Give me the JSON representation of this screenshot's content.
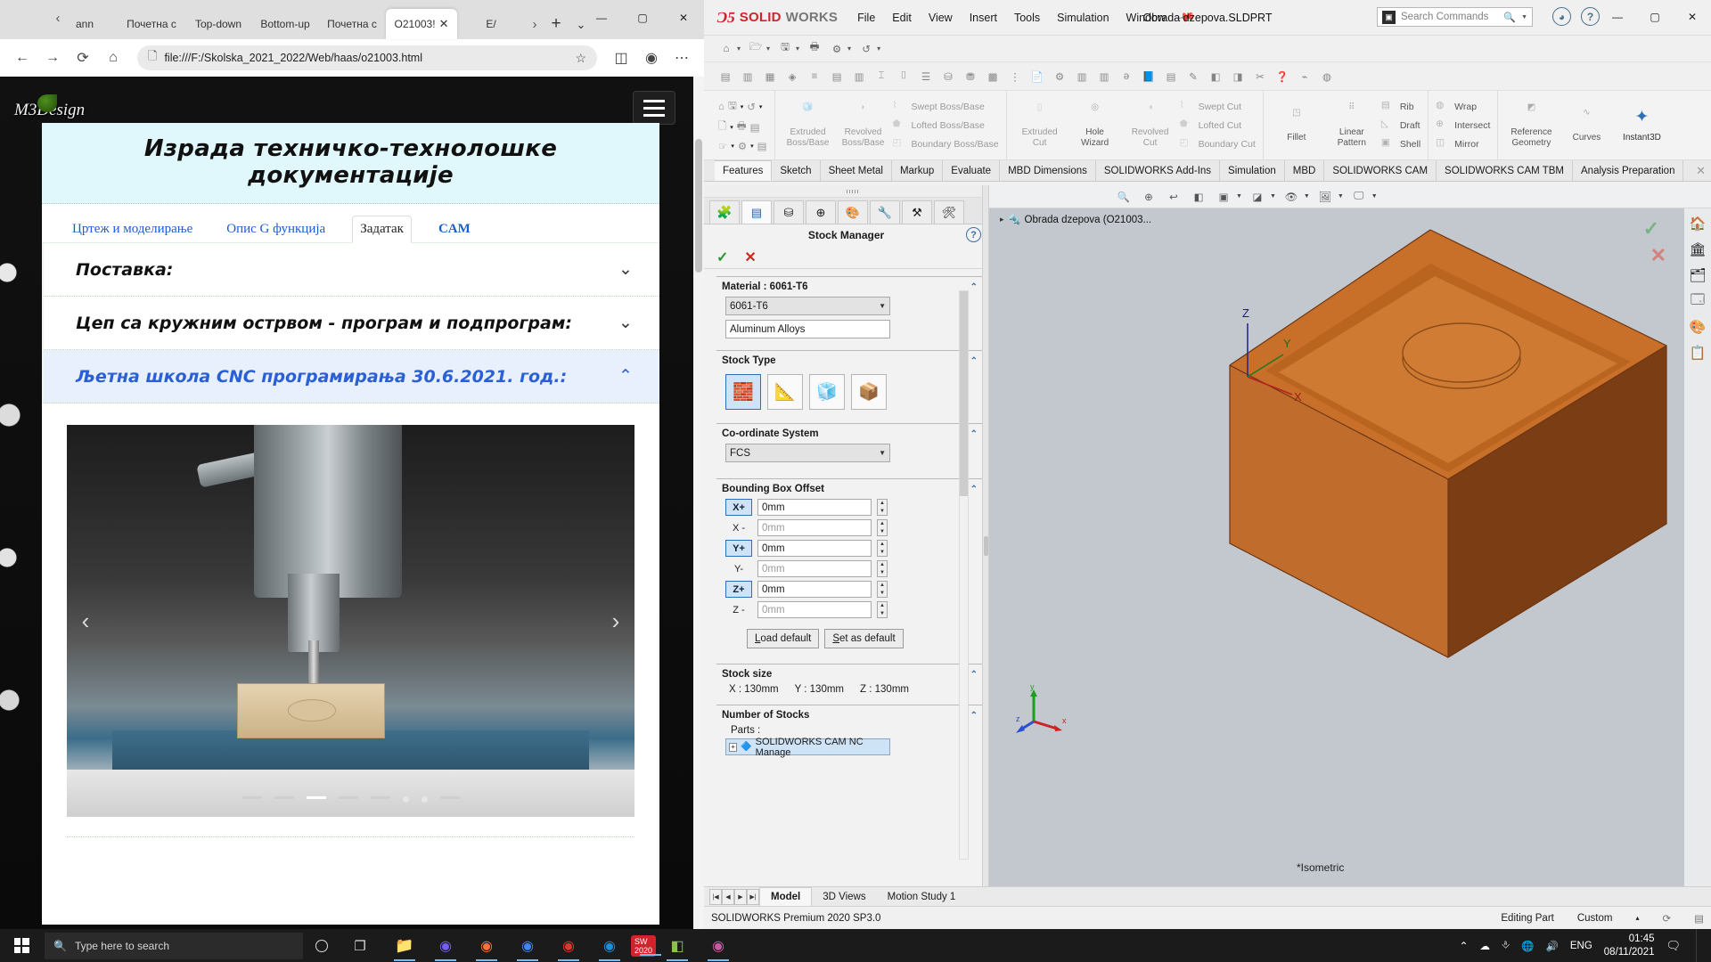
{
  "browser": {
    "tabs": [
      {
        "label": "ann",
        "active": false
      },
      {
        "label": "Почетна с",
        "active": false
      },
      {
        "label": "Top-down",
        "active": false
      },
      {
        "label": "Bottom-up",
        "active": false
      },
      {
        "label": "Почетна с",
        "active": false
      },
      {
        "label": "O21003!",
        "active": true
      },
      {
        "label": "E/",
        "active": false
      }
    ],
    "new_tab_label": "+",
    "tab_list_caret": "⌄",
    "nav_prev": "‹",
    "nav_next": "›",
    "back_icon": "←",
    "forward_icon": "→",
    "reload_icon": "⟳",
    "home_icon": "⌂",
    "url": "file:///F:/Skolska_2021_2022/Web/haas/o21003.html",
    "favorite_icon": "☆",
    "collections_icon": "◫",
    "profile_icon": "◉",
    "more_icon": "⋯",
    "window": {
      "minimize": "—",
      "maximize": "▢",
      "close": "✕"
    }
  },
  "page": {
    "logo_text": "M3Design",
    "menu_button": "hamburger",
    "title": "Израда техничко-технолошке документације",
    "tabs": [
      {
        "label": "Цртеж и моделирање",
        "active": false,
        "bold": false
      },
      {
        "label": "Опис G функција",
        "active": false,
        "bold": false
      },
      {
        "label": "Задатак",
        "active": true,
        "bold": false
      },
      {
        "label": "CAM",
        "active": false,
        "bold": true
      }
    ],
    "accordions": [
      {
        "title": "Поставка:",
        "expanded": false,
        "chevron": "⌄"
      },
      {
        "title": "Цеп са кружним острвом - програм и подпрограм:",
        "expanded": false,
        "chevron": "⌄"
      },
      {
        "title": "Љетна школа CNC програмирања 30.6.2021. год.:",
        "expanded": true,
        "chevron": "⌃"
      }
    ],
    "carousel": {
      "prev": "‹",
      "next": "›",
      "slide_count": 8,
      "active_slide": 3,
      "caption": ""
    }
  },
  "solidworks": {
    "brand_mark": "Ɔ5",
    "brand_solid": "SOLID",
    "brand_works": "WORKS",
    "menu": [
      "File",
      "Edit",
      "View",
      "Insert",
      "Tools",
      "Simulation",
      "Window"
    ],
    "pin_icon": "pin-icon",
    "document_title": "Obrada dzepova.SLDPRT",
    "search_placeholder": "Search Commands",
    "search_icon": "search-commands-icon",
    "title_icons": [
      "user-icon",
      "help-icon"
    ],
    "window": {
      "minimize": "—",
      "maximize": "▢",
      "close": "✕"
    },
    "ribbon_tabs": [
      {
        "label": "Features",
        "active": true
      },
      {
        "label": "Sketch",
        "active": false
      },
      {
        "label": "Sheet Metal",
        "active": false
      },
      {
        "label": "Markup",
        "active": false
      },
      {
        "label": "Evaluate",
        "active": false
      },
      {
        "label": "MBD Dimensions",
        "active": false
      },
      {
        "label": "SOLIDWORKS Add-Ins",
        "active": false
      },
      {
        "label": "Simulation",
        "active": false
      },
      {
        "label": "MBD",
        "active": false
      },
      {
        "label": "SOLIDWORKS CAM",
        "active": false
      },
      {
        "label": "SOLIDWORKS CAM TBM",
        "active": false
      },
      {
        "label": "Analysis Preparation",
        "active": false
      }
    ],
    "ribbon_close": "✕",
    "ribbon_groups": [
      {
        "big": [],
        "smalls": []
      },
      {
        "big": [
          {
            "label": "Extruded\nBoss/Base",
            "icon": "extruded-boss-icon"
          },
          {
            "label": "Revolved\nBoss/Base",
            "icon": "revolved-boss-icon"
          }
        ],
        "smalls": [
          "Swept Boss/Base",
          "Lofted Boss/Base",
          "Boundary Boss/Base"
        ]
      },
      {
        "big": [
          {
            "label": "Extruded\nCut",
            "icon": "extruded-cut-icon"
          },
          {
            "label": "Hole\nWizard",
            "icon": "hole-wizard-icon"
          },
          {
            "label": "Revolved\nCut",
            "icon": "revolved-cut-icon"
          }
        ],
        "smalls": [
          "Swept Cut",
          "Lofted Cut",
          "Boundary Cut"
        ]
      },
      {
        "big": [
          {
            "label": "Fillet",
            "icon": "fillet-icon"
          },
          {
            "label": "Linear\nPattern",
            "icon": "linear-pattern-icon"
          }
        ],
        "smalls": [
          "Rib",
          "Draft",
          "Shell"
        ]
      },
      {
        "big": [],
        "smalls": [
          "Wrap",
          "Intersect",
          "Mirror"
        ]
      },
      {
        "big": [
          {
            "label": "Reference\nGeometry",
            "icon": "reference-geometry-icon"
          },
          {
            "label": "Curves",
            "icon": "curves-icon"
          },
          {
            "label": "Instant3D",
            "icon": "instant3d-icon"
          }
        ],
        "smalls": []
      }
    ],
    "property_manager": {
      "tabs": [
        "feature-manager-icon",
        "property-manager-icon",
        "configuration-manager-icon",
        "dimxpert-icon",
        "appearances-icon",
        "cam-feature-tree-icon",
        "cam-operation-tree-icon",
        "cam-tools-icon"
      ],
      "title": "Stock Manager",
      "help_icon": "?",
      "ok_icon": "✓",
      "cancel_icon": "✕",
      "sections": {
        "material": {
          "header": "Material : 6061-T6",
          "select_value": "6061-T6",
          "textbox_value": "Aluminum Alloys"
        },
        "stock_type": {
          "header": "Stock Type",
          "options": [
            "block-stock-icon",
            "extruded-sketch-stock-icon",
            "stl-stock-icon",
            "part-stock-icon"
          ],
          "selected_index": 0
        },
        "coordinate_system": {
          "header": "Co-ordinate System",
          "value": "FCS"
        },
        "bounding_box_offset": {
          "header": "Bounding Box Offset",
          "rows": [
            {
              "label": "X+",
              "value": "0mm",
              "active": true
            },
            {
              "label": "X -",
              "value": "0mm",
              "active": false
            },
            {
              "label": "Y+",
              "value": "0mm",
              "active": true
            },
            {
              "label": "Y-",
              "value": "0mm",
              "active": false
            },
            {
              "label": "Z+",
              "value": "0mm",
              "active": true
            },
            {
              "label": "Z -",
              "value": "0mm",
              "active": false
            }
          ],
          "buttons": [
            "Load default",
            "Set as default"
          ]
        },
        "stock_size": {
          "header": "Stock size",
          "x": "X : 130mm",
          "y": "Y : 130mm",
          "z": "Z : 130mm"
        },
        "number_of_stocks": {
          "header": "Number of Stocks",
          "parts_label": "Parts :",
          "tree_item": "SOLIDWORKS CAM NC Manage"
        }
      }
    },
    "graphics": {
      "tree_root": "Obrada dzepova  (O21003...",
      "tree_caret": "▸",
      "view_orientation": "*Isometric",
      "triad_labels": [
        "x",
        "y",
        "z"
      ],
      "origin_labels": [
        "X",
        "Y",
        "Z"
      ],
      "confirm_check": "✓",
      "confirm_close": "✕"
    },
    "bottom_tabs": [
      {
        "label": "Model",
        "active": true
      },
      {
        "label": "3D Views",
        "active": false
      },
      {
        "label": "Motion Study 1",
        "active": false
      }
    ],
    "status_bar": {
      "version": "SOLIDWORKS Premium 2020 SP3.0",
      "edit_state": "Editing Part",
      "units": "Custom",
      "units_caret": "▴"
    }
  },
  "taskbar": {
    "start_icon": "windows-start-icon",
    "search_placeholder": "Type here to search",
    "search_icon": "search-icon",
    "cortana_icon": "cortana-icon",
    "task_view_icon": "task-view-icon",
    "apps": [
      {
        "name": "file-explorer-icon",
        "running": true
      },
      {
        "name": "viber-icon",
        "running": true
      },
      {
        "name": "firefox-icon",
        "running": true
      },
      {
        "name": "chrome-icon",
        "running": true
      },
      {
        "name": "opera-icon",
        "running": true
      },
      {
        "name": "edge-icon",
        "running": true
      },
      {
        "name": "solidworks-2020-icon",
        "running": true
      },
      {
        "name": "notepadpp-icon",
        "running": true
      },
      {
        "name": "app-icon",
        "running": true
      }
    ],
    "tray": {
      "chevron": "⌃",
      "icons": [
        "onedrive-icon",
        "usb-icon",
        "network-icon",
        "volume-icon"
      ],
      "language": "ENG",
      "time": "01:45",
      "date": "08/11/2021",
      "notification_icon": "notifications-icon"
    }
  }
}
